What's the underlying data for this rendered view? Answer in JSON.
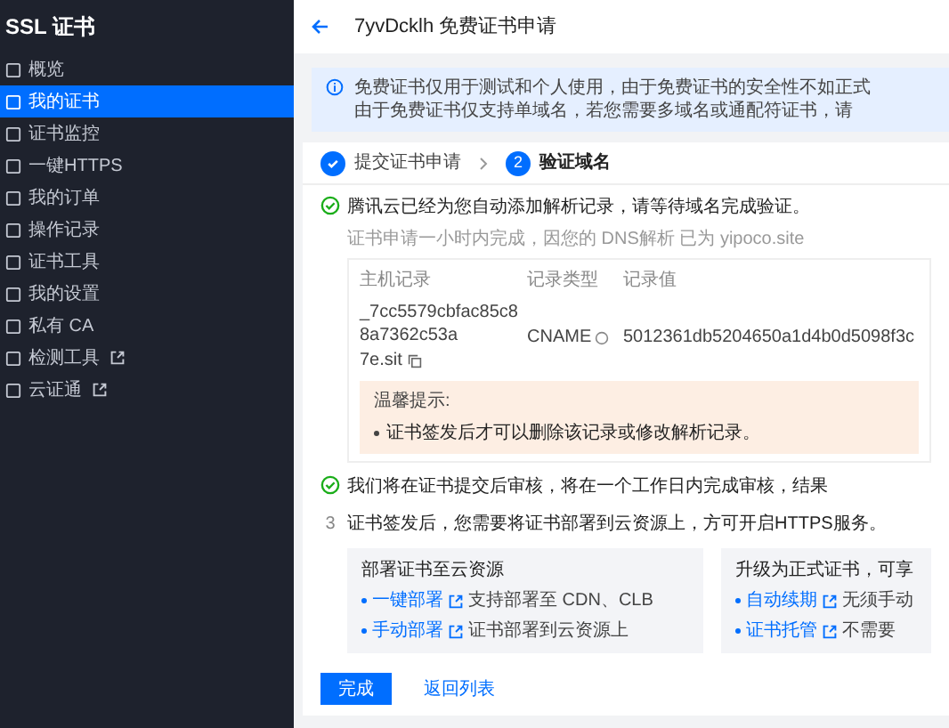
{
  "sidebar": {
    "title": "SSL 证书",
    "items": [
      {
        "label": "概览",
        "selected": false,
        "external": false
      },
      {
        "label": "我的证书",
        "selected": true,
        "external": false
      },
      {
        "label": "证书监控",
        "selected": false,
        "external": false
      },
      {
        "label": "一键HTTPS",
        "selected": false,
        "external": false
      },
      {
        "label": "我的订单",
        "selected": false,
        "external": false
      },
      {
        "label": "操作记录",
        "selected": false,
        "external": false
      },
      {
        "label": "证书工具",
        "selected": false,
        "external": false
      },
      {
        "label": "我的设置",
        "selected": false,
        "external": false
      },
      {
        "label": "私有 CA",
        "selected": false,
        "external": false
      },
      {
        "label": "检测工具",
        "selected": false,
        "external": true
      },
      {
        "label": "云证通",
        "selected": false,
        "external": true
      }
    ]
  },
  "header": {
    "title": "7yvDcklh 免费证书申请"
  },
  "notice": {
    "lines": [
      "免费证书仅用于测试和个人使用，由于免费证书的安全性不如正式",
      "由于免费证书仅支持单域名，若您需要多域名或通配符证书，请"
    ]
  },
  "steps": [
    {
      "label": "提交证书申请",
      "done": true
    },
    {
      "label": "验证域名",
      "number": "2",
      "done": false
    }
  ],
  "progress": [
    {
      "kind": "check",
      "text": "腾讯云已经为您自动添加解析记录，请等待域名完成验证。",
      "sub": "证书申请一小时内完成，因您的 DNS解析 已为 yipoco.site"
    },
    {
      "kind": "check",
      "text": "我们将在证书提交后审核，将在一个工作日内完成审核，结果"
    },
    {
      "kind": "number",
      "number": "3",
      "text": "证书签发后，您需要将证书部署到云资源上，方可开启HTTPS服务。"
    }
  ],
  "record_table": {
    "columns": [
      "主机记录",
      "记录类型",
      "记录值"
    ],
    "rows": [
      {
        "host": "_7cc5579cbfac85c88a7362c53a",
        "host_suffix": "7e.sit",
        "type": "CNAME",
        "value": "5012361db5204650a1d4b0d5098f3c"
      }
    ]
  },
  "tip": {
    "title": "温馨提示:",
    "items": [
      "证书签发后才可以删除该记录或修改解析记录。"
    ]
  },
  "cards": [
    {
      "title": "部署证书至云资源",
      "links": [
        {
          "label": "一键部署",
          "desc": "支持部署至 CDN、CLB"
        },
        {
          "label": "手动部署",
          "desc": "证书部署到云资源上"
        }
      ]
    },
    {
      "title": "升级为正式证书，可享",
      "links": [
        {
          "label": "自动续期",
          "desc": "无须手动"
        },
        {
          "label": "证书托管",
          "desc": "不需要"
        }
      ]
    }
  ],
  "buttons": {
    "primary": "完成",
    "secondary": "返回列表"
  }
}
